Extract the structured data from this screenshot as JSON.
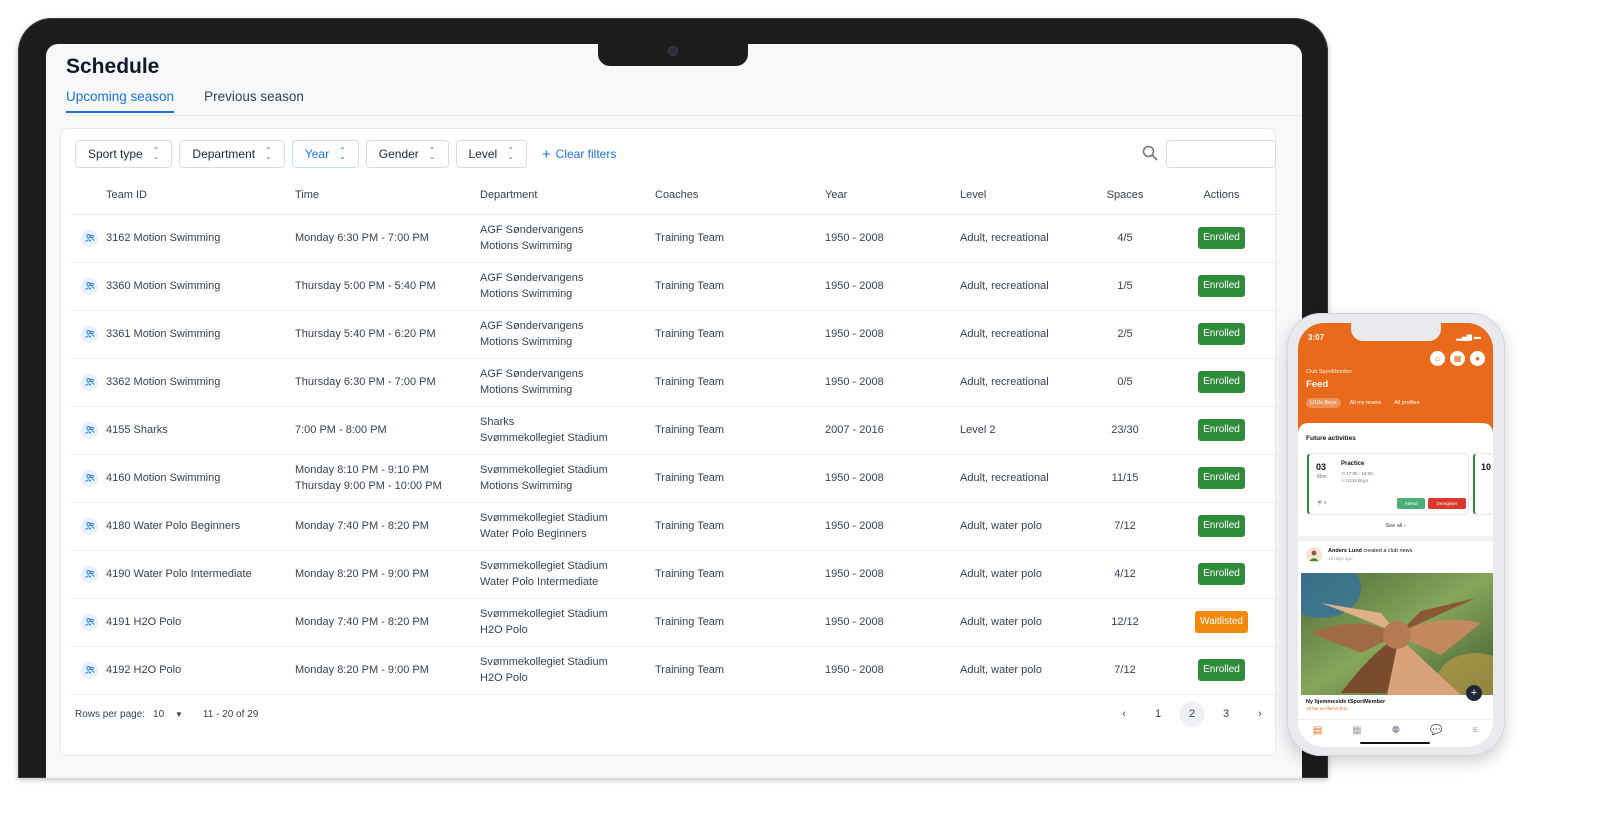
{
  "app": {
    "title": "Schedule",
    "tabs": [
      {
        "label": "Upcoming season",
        "active": true
      },
      {
        "label": "Previous season",
        "active": false
      }
    ]
  },
  "filters": {
    "items": [
      {
        "label": "Sport type",
        "active": false
      },
      {
        "label": "Department",
        "active": false
      },
      {
        "label": "Year",
        "active": true
      },
      {
        "label": "Gender",
        "active": false
      },
      {
        "label": "Level",
        "active": false
      }
    ],
    "clear_label": "Clear filters",
    "search_placeholder": ""
  },
  "table": {
    "columns": [
      "Team ID",
      "Time",
      "Department",
      "Coaches",
      "Year",
      "Level",
      "Spaces",
      "Actions"
    ],
    "rows": [
      {
        "team": "3162 Motion Swimming",
        "time": [
          "Monday 6:30 PM - 7:00 PM"
        ],
        "department": [
          "AGF Søndervangens",
          "Motions Swimming"
        ],
        "coaches": "Training Team",
        "year": "1950 - 2008",
        "level": "Adult, recreational",
        "spaces": "4/5",
        "status": "Enrolled"
      },
      {
        "team": "3360 Motion Swimming",
        "time": [
          "Thursday 5:00 PM - 5:40 PM"
        ],
        "department": [
          "AGF Søndervangens",
          "Motions Swimming"
        ],
        "coaches": "Training Team",
        "year": "1950 - 2008",
        "level": "Adult, recreational",
        "spaces": "1/5",
        "status": "Enrolled"
      },
      {
        "team": "3361 Motion Swimming",
        "time": [
          "Thursday 5:40 PM - 6:20 PM"
        ],
        "department": [
          "AGF Søndervangens",
          "Motions Swimming"
        ],
        "coaches": "Training Team",
        "year": "1950 - 2008",
        "level": "Adult, recreational",
        "spaces": "2/5",
        "status": "Enrolled"
      },
      {
        "team": "3362 Motion Swimming",
        "time": [
          "Thursday 6:30 PM - 7:00 PM"
        ],
        "department": [
          "AGF Søndervangens",
          "Motions Swimming"
        ],
        "coaches": "Training Team",
        "year": "1950 - 2008",
        "level": "Adult, recreational",
        "spaces": "0/5",
        "status": "Enrolled"
      },
      {
        "team": "4155 Sharks",
        "time": [
          "7:00 PM - 8:00 PM"
        ],
        "department": [
          "Sharks",
          "Svømmekollegiet Stadium"
        ],
        "coaches": "Training Team",
        "year": "2007 - 2016",
        "level": "Level 2",
        "spaces": "23/30",
        "status": "Enrolled"
      },
      {
        "team": "4160 Motion Swimming",
        "time": [
          "Monday 8:10 PM - 9:10 PM",
          "Thursday 9:00 PM - 10:00 PM"
        ],
        "department": [
          "Svømmekollegiet Stadium",
          "Motions Swimming"
        ],
        "coaches": "Training Team",
        "year": "1950 - 2008",
        "level": "Adult, recreational",
        "spaces": "11/15",
        "status": "Enrolled"
      },
      {
        "team": "4180 Water Polo Beginners",
        "time": [
          "Monday 7:40 PM - 8:20 PM"
        ],
        "department": [
          "Svømmekollegiet Stadium",
          "Water Polo Beginners"
        ],
        "coaches": "Training Team",
        "year": "1950 - 2008",
        "level": "Adult, water polo",
        "spaces": "7/12",
        "status": "Enrolled"
      },
      {
        "team": "4190 Water Polo Intermediate",
        "time": [
          "Monday 8:20 PM - 9:00 PM"
        ],
        "department": [
          "Svømmekollegiet Stadium",
          "Water Polo Intermediate"
        ],
        "coaches": "Training Team",
        "year": "1950 - 2008",
        "level": "Adult, water polo",
        "spaces": "4/12",
        "status": "Enrolled"
      },
      {
        "team": "4191 H2O Polo",
        "time": [
          "Monday 7:40 PM - 8:20 PM"
        ],
        "department": [
          "Svømmekollegiet Stadium",
          "H2O Polo"
        ],
        "coaches": "Training Team",
        "year": "1950 - 2008",
        "level": "Adult, water polo",
        "spaces": "12/12",
        "status": "Waitlisted"
      },
      {
        "team": "4192 H2O Polo",
        "time": [
          "Monday 8:20 PM - 9:00 PM"
        ],
        "department": [
          "Svømmekollegiet Stadium",
          "H2O Polo"
        ],
        "coaches": "Training Team",
        "year": "1950 - 2008",
        "level": "Adult, water polo",
        "spaces": "7/12",
        "status": "Enrolled"
      }
    ]
  },
  "pagination": {
    "rows_label": "Rows per page:",
    "rows_value": "10",
    "range": "11 - 20 of 29",
    "pages": [
      "1",
      "2",
      "3"
    ],
    "current": "2"
  },
  "phone": {
    "time": "3:07",
    "club": "Club SportMember",
    "title": "Feed",
    "pills": [
      {
        "label": "U12s Boys",
        "active": true
      },
      {
        "label": "All my teams",
        "active": false
      },
      {
        "label": "All profiles",
        "active": false
      }
    ],
    "section": "Future activities",
    "activity": {
      "day": "03",
      "weekday": "Mon",
      "name": "Practice",
      "time": "17:00 - 18:00",
      "team": "U12s Boys",
      "count": "6",
      "attend": "Attend",
      "deregister": "Deregister"
    },
    "activity2_day": "10",
    "see_all": "See all",
    "news": {
      "author": "Anders Lund",
      "action": "created a club news",
      "age": "16 days ago"
    },
    "caption": "Ny hjemmeside tSportMember",
    "caption_sub": "All har nu fået et flot..."
  },
  "colors": {
    "accent": "#1a73e8",
    "enrolled": "#2e8b3a",
    "waitlisted": "#f2890c",
    "phone_brand": "#ea6a1c"
  }
}
